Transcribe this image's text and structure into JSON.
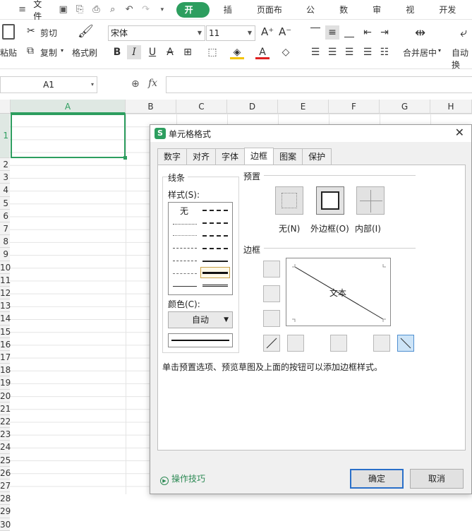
{
  "menubar": {
    "file_label": "文件",
    "tabs": [
      "开始",
      "插入",
      "页面布局",
      "公式",
      "数据",
      "审阅",
      "视图",
      "开发工"
    ],
    "active_tab": "开始"
  },
  "ribbon": {
    "paste_label": "粘贴",
    "cut_label": "剪切",
    "copy_label": "复制",
    "format_painter_label": "格式刷",
    "font_name": "宋体",
    "font_size": "11",
    "bold": "B",
    "italic": "I",
    "underline": "U",
    "merge_label": "合并居中",
    "autowrap_label": "自动换"
  },
  "formula_bar": {
    "name_box": "A1",
    "fx": "fx"
  },
  "grid": {
    "columns": [
      "A",
      "B",
      "C",
      "D",
      "E",
      "F",
      "G",
      "H"
    ],
    "rows": [
      "1",
      "2",
      "3",
      "4",
      "5",
      "6",
      "7",
      "8",
      "9",
      "10",
      "11",
      "12",
      "13",
      "14",
      "15",
      "16",
      "17",
      "18",
      "19",
      "20",
      "21",
      "22",
      "23",
      "24",
      "25",
      "26",
      "27",
      "28",
      "29",
      "30"
    ]
  },
  "dialog": {
    "title": "单元格格式",
    "tabs": [
      "数字",
      "对齐",
      "字体",
      "边框",
      "图案",
      "保护"
    ],
    "active_tab": "边框",
    "line_group": "线条",
    "style_label": "样式(S):",
    "style_none": "无",
    "color_label": "颜色(C):",
    "color_value": "自动",
    "preset_group": "预置",
    "preset_none": "无(N)",
    "preset_outline": "外边框(O)",
    "preset_inside": "内部(I)",
    "border_group": "边框",
    "preview_text": "文本",
    "hint": "单击预置选项、预览草图及上面的按钮可以添加边框样式。",
    "tips_link": "操作技巧",
    "ok": "确定",
    "cancel": "取消"
  }
}
